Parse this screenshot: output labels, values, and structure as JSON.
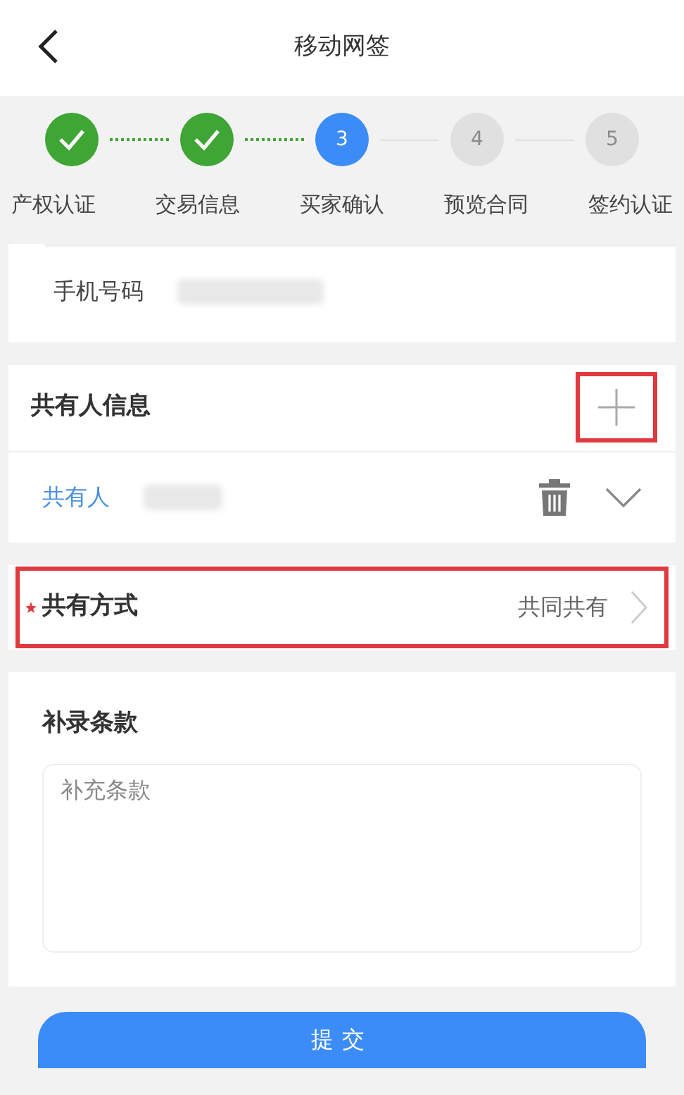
{
  "header": {
    "title": "移动网签"
  },
  "steps": [
    {
      "label": "产权认证",
      "kind": "done"
    },
    {
      "label": "交易信息",
      "kind": "done"
    },
    {
      "label": "买家确认",
      "kind": "current",
      "number": "3"
    },
    {
      "label": "预览合同",
      "kind": "pending",
      "number": "4"
    },
    {
      "label": "签约认证",
      "kind": "pending",
      "number": "5"
    }
  ],
  "phone": {
    "label": "手机号码"
  },
  "co_owners": {
    "title": "共有人信息",
    "add_highlighted": true,
    "items": [
      {
        "label": "共有人",
        "expanded": false
      }
    ]
  },
  "ownership": {
    "label": "共有方式",
    "required": true,
    "value": "共同共有",
    "highlighted": true
  },
  "clauses": {
    "title": "补录条款",
    "placeholder": "补充条款"
  },
  "submit": {
    "label": "提交"
  }
}
